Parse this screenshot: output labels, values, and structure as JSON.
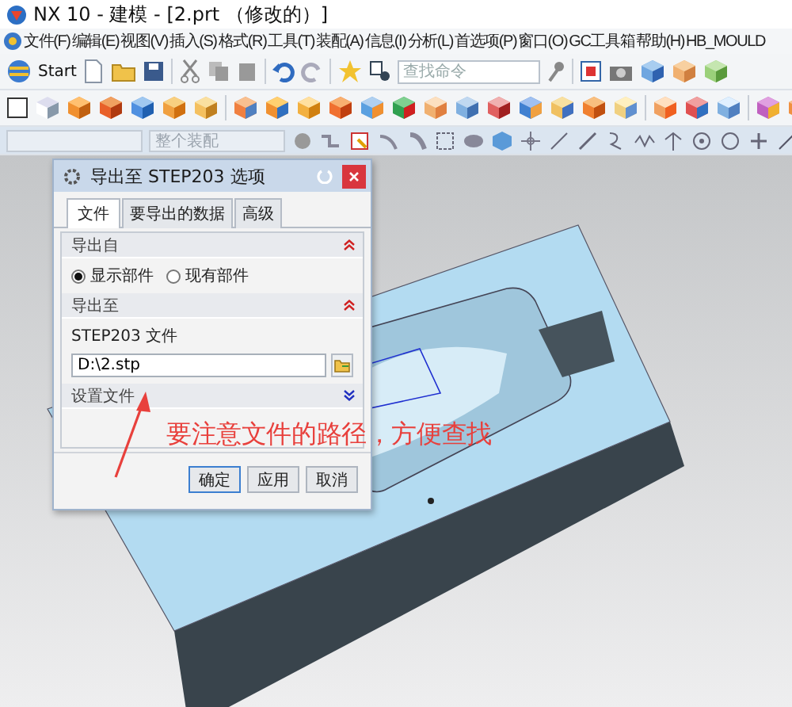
{
  "window": {
    "title": "NX 10 - 建模 - [2.prt （修改的）]"
  },
  "menu": [
    "文件(F)",
    "编辑(E)",
    "视图(V)",
    "插入(S)",
    "格式(R)",
    "工具(T)",
    "装配(A)",
    "信息(I)",
    "分析(L)",
    "首选项(P)",
    "窗口(O)",
    "GC工具箱",
    "帮助(H)",
    "HB_MOULD"
  ],
  "toolbar": {
    "start_label": "Start",
    "search": {
      "placeholder": "查找命令"
    },
    "assembly_selector": {
      "value": "整个装配",
      "disabled": true
    }
  },
  "dialog": {
    "title": "导出至 STEP203 选项",
    "tabs": [
      {
        "label": "文件",
        "selected": true
      },
      {
        "label": "要导出的数据",
        "selected": false
      },
      {
        "label": "高级",
        "selected": false
      }
    ],
    "sections": [
      {
        "kind": "radios",
        "title": "导出自",
        "expanded": true,
        "options": [
          {
            "label": "显示部件",
            "selected": true
          },
          {
            "label": "现有部件",
            "selected": false
          }
        ]
      },
      {
        "kind": "file",
        "title": "导出至",
        "expanded": true,
        "field_label": "STEP203 文件",
        "value": "D:\\2.stp"
      },
      {
        "title": "设置文件",
        "expanded": false
      }
    ],
    "buttons": [
      {
        "label": "确定",
        "default": true
      },
      {
        "label": "应用",
        "default": false
      },
      {
        "label": "取消",
        "default": false
      }
    ]
  },
  "annotation": "要注意文件的路径，方便查找"
}
